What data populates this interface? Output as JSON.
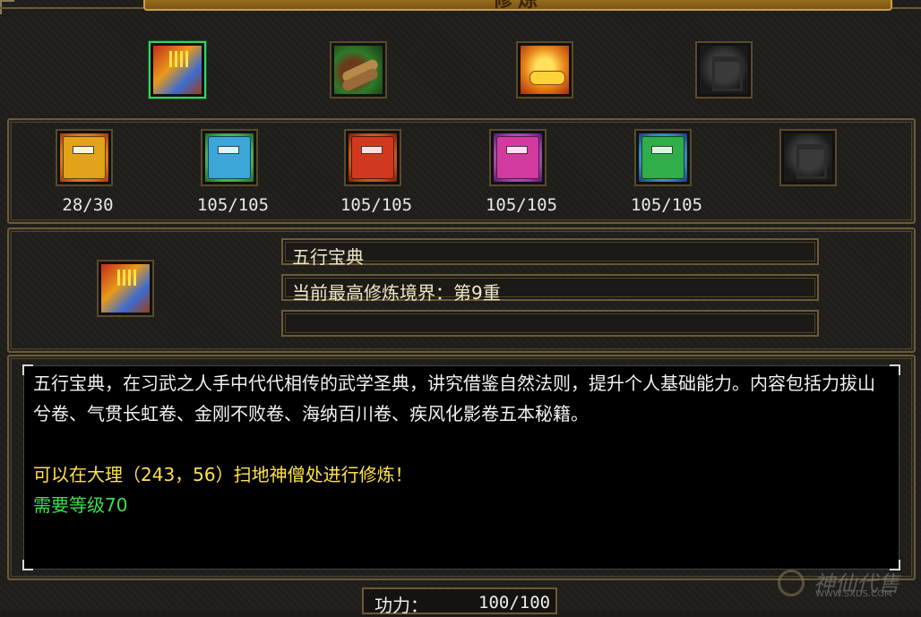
{
  "window": {
    "title": "修炼"
  },
  "top_slots": [
    {
      "name": "wuxing-baodian-slot",
      "selected": true
    },
    {
      "name": "scroll-bundle-slot",
      "selected": false
    },
    {
      "name": "gold-scroll-slot",
      "selected": false
    },
    {
      "name": "empty-slot",
      "selected": false
    }
  ],
  "books": [
    {
      "count": "28/30",
      "color": "#e2a21a"
    },
    {
      "count": "105/105",
      "color": "#3aa7d8"
    },
    {
      "count": "105/105",
      "color": "#d2381e"
    },
    {
      "count": "105/105",
      "color": "#d23aa0"
    },
    {
      "count": "105/105",
      "color": "#2fae4a"
    }
  ],
  "info": {
    "book_name": "五行宝典",
    "realm": "当前最高修炼境界：第9重",
    "extra": ""
  },
  "description": {
    "text": "五行宝典，在习武之人手中代代相传的武学圣典，讲究借鉴自然法则，提升个人基础能力。内容包括力拔山兮卷、气贯长虹卷、金刚不败卷、海纳百川卷、疾风化影卷五本秘籍。",
    "location": "可以在大理（243，56）扫地神僧处进行修炼！",
    "level_req": "需要等级70"
  },
  "power": {
    "label": "功力：",
    "value": "100/100"
  },
  "watermark": {
    "logo_text": "神仙代售",
    "url": "WWW.SXDS.COM"
  },
  "colors": {
    "accent_gold": "#c8a24a",
    "text_yellow": "#ffe24a",
    "text_green": "#3be04d",
    "selected_border": "#3bd06a"
  }
}
